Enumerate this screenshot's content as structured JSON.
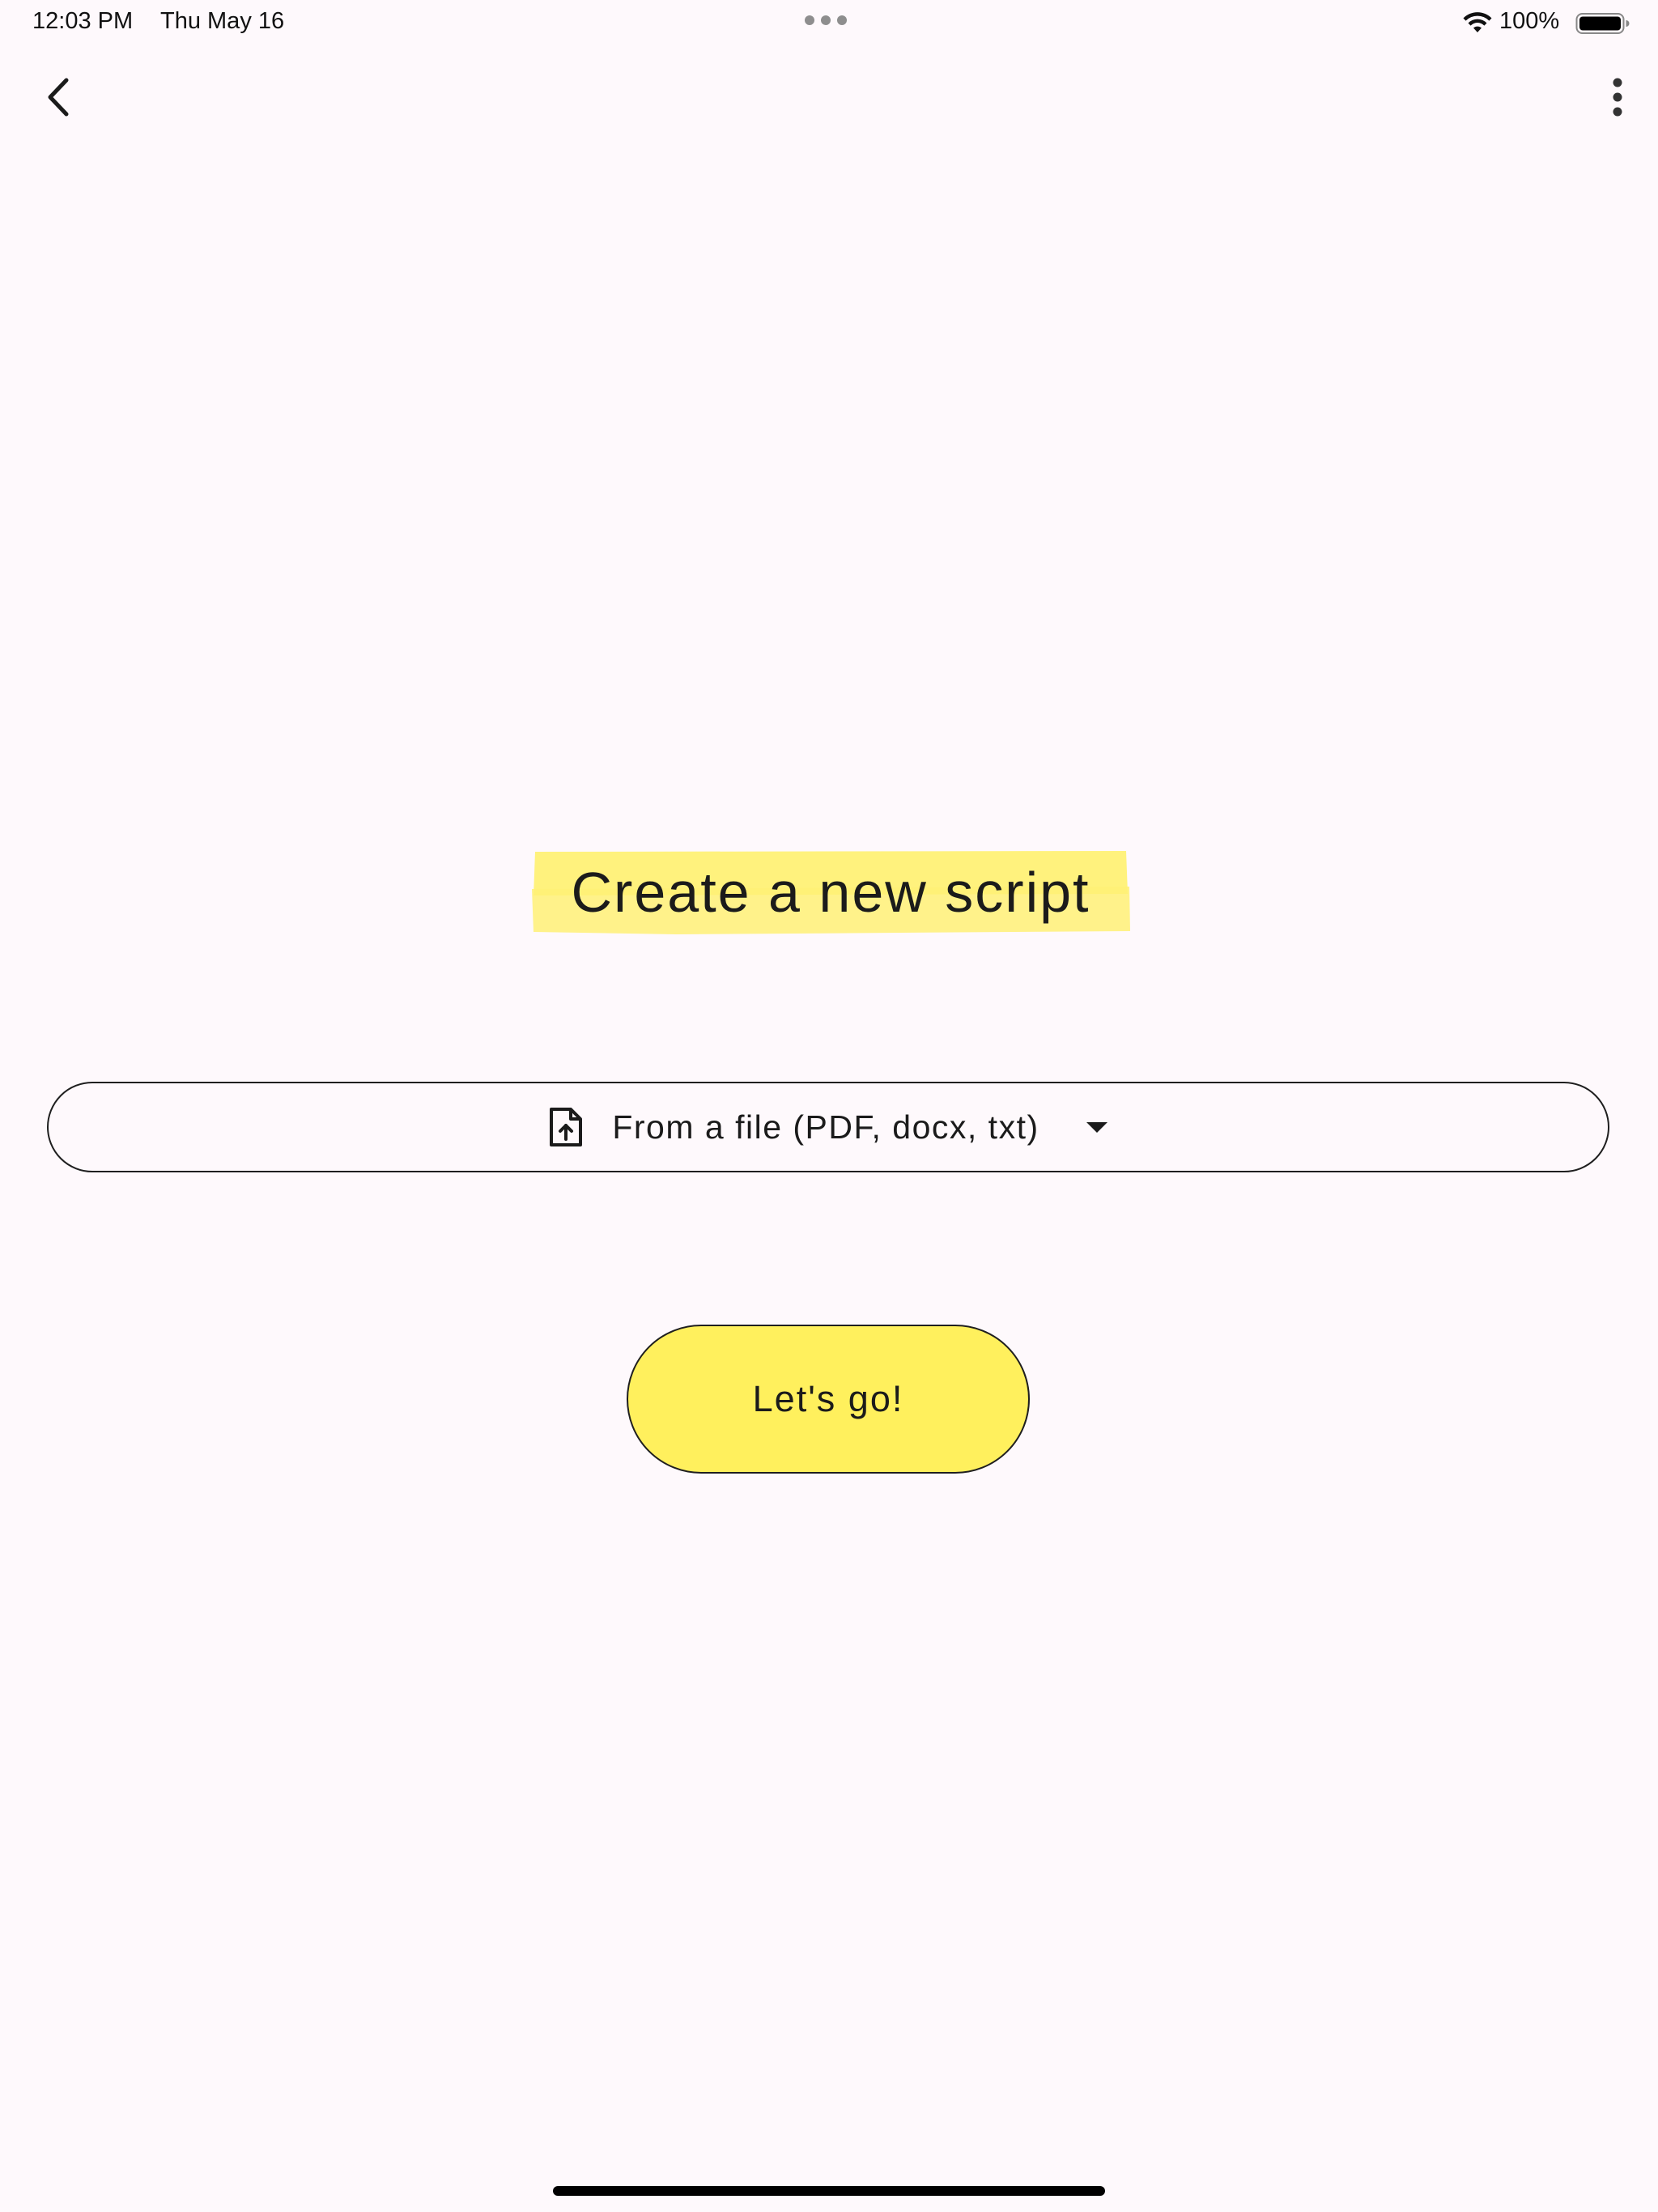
{
  "status_bar": {
    "time": "12:03 PM",
    "date": "Thu May 16",
    "battery_percent": "100%",
    "battery_level": 1.0,
    "wifi_icon": "wifi-icon",
    "battery_icon": "battery-icon",
    "multitask_icon": "multitask-dots-icon"
  },
  "nav": {
    "back_icon": "chevron-left-icon",
    "more_icon": "more-vertical-icon"
  },
  "main": {
    "title": "Create a new script",
    "title_highlight_color": "#fff176",
    "source_select": {
      "icon": "file-upload-icon",
      "selected_label": "From a file (PDF, docx, txt)",
      "dropdown_icon": "caret-down-icon"
    },
    "go_button": {
      "label": "Let's go!",
      "color": "#fff05d"
    }
  },
  "colors": {
    "background": "#fef9fc",
    "accent_yellow": "#fff05d",
    "text": "#1b1b1b"
  }
}
